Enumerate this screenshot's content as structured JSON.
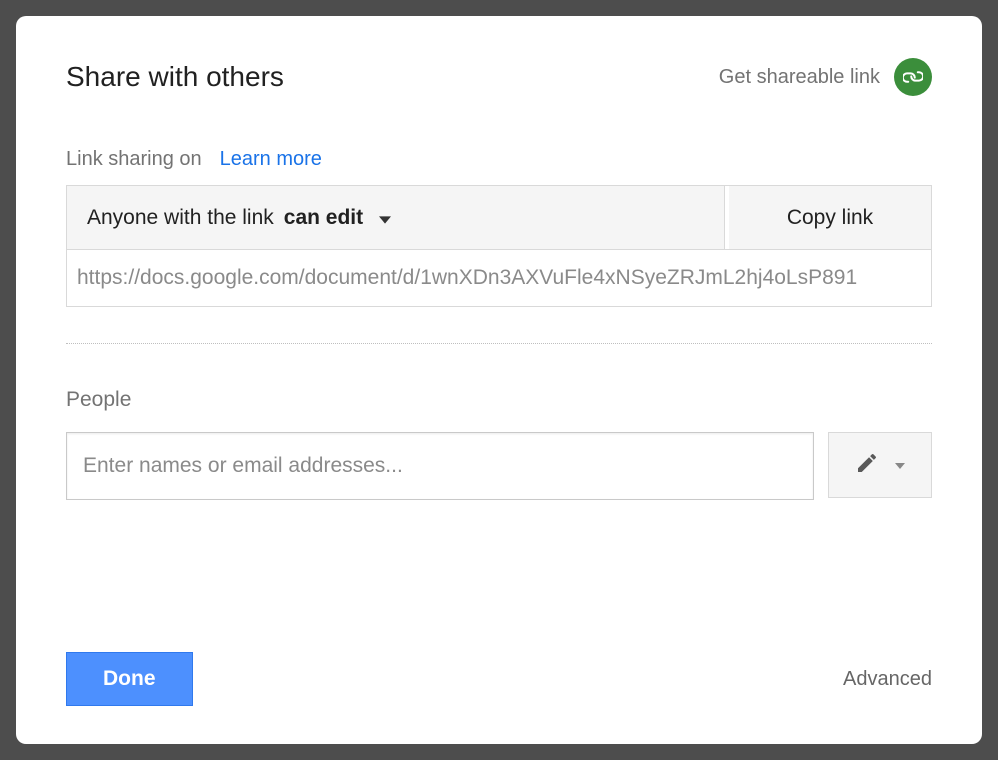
{
  "dialog": {
    "title": "Share with others",
    "shareable_link_label": "Get shareable link"
  },
  "link_sharing": {
    "status_label": "Link sharing on",
    "learn_more": "Learn more",
    "permission_prefix": "Anyone with the link",
    "permission_level": "can edit",
    "copy_button": "Copy link",
    "url": "https://docs.google.com/document/d/1wnXDn3AXVuFle4xNSyeZRJmL2hj4oLsP891"
  },
  "people": {
    "label": "People",
    "placeholder": "Enter names or email addresses..."
  },
  "footer": {
    "done": "Done",
    "advanced": "Advanced"
  }
}
